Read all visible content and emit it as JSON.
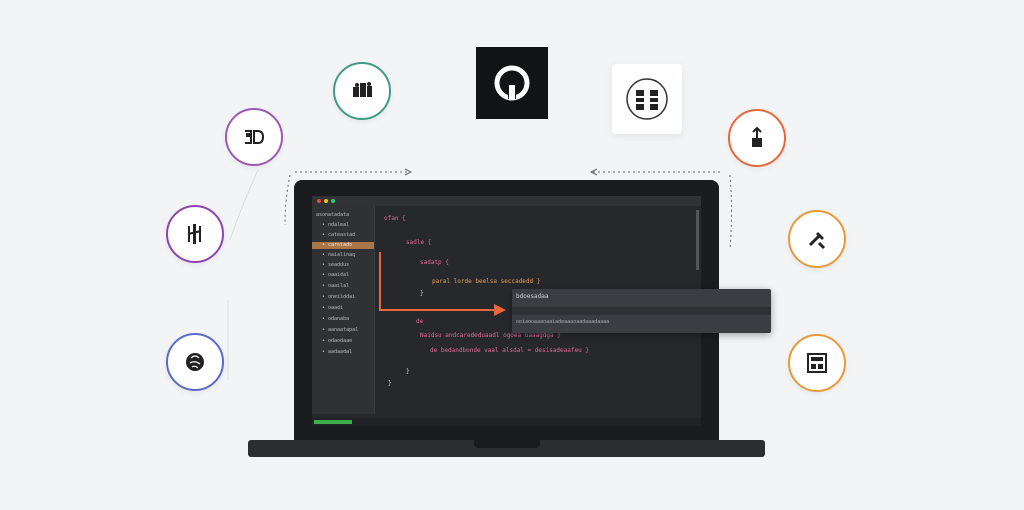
{
  "editor": {
    "sidebar_items": [
      "asonatadata",
      "• ndaleal",
      "• cateastad",
      "• carotado",
      "• naialinaq",
      "• seaddus",
      "• oaaidal",
      "• oaailal",
      "• oneiiddai",
      "• oaadi",
      "• odanaba",
      "• aanaatapal",
      "• odaodaae",
      "• aadaadal"
    ],
    "code_lines": [
      {
        "text": "ofan {",
        "color": "#e06a9c"
      },
      {
        "text": "sadle  {",
        "color": "#e06a9c"
      },
      {
        "text": "sadatp  {",
        "color": "#e06a9c"
      },
      {
        "text": "paral lorde beelsa   seccadedd  }",
        "color": "#e3a35c"
      },
      {
        "text": "}",
        "color": "#c9cbd0"
      },
      {
        "text": "}",
        "color": "#c9cbd0"
      },
      {
        "text": "de",
        "color": "#e06a9c"
      },
      {
        "text": "Naidsu  andcarededuaadl  ogoea  Gaaagdga  }",
        "color": "#e06a9c"
      },
      {
        "text": "de  bedandbonde  vaal  alsdal  =  desisadeaafeu }",
        "color": "#e06a9c"
      },
      {
        "text": "}",
        "color": "#c9cbd0"
      },
      {
        "text": "}",
        "color": "#c9cbd0"
      }
    ],
    "popup_title": "bdoesadaa",
    "popup_detail": "ooiaooaaaoaaiadeaaaoaadaaadaaaa"
  },
  "colors": {
    "accent_orange": "#e8673a",
    "status_green": "#3fae4a",
    "sidebar_active": "#a9764a"
  },
  "icons": {
    "top_center": "github-icon",
    "top_left": "group-icon",
    "top_right": "stack-icon",
    "left_1": "docker-icon",
    "left_2": "music-icon",
    "left_3": "brain-icon",
    "right_1": "upload-icon",
    "right_2": "tools-icon",
    "right_3": "layout-icon"
  }
}
